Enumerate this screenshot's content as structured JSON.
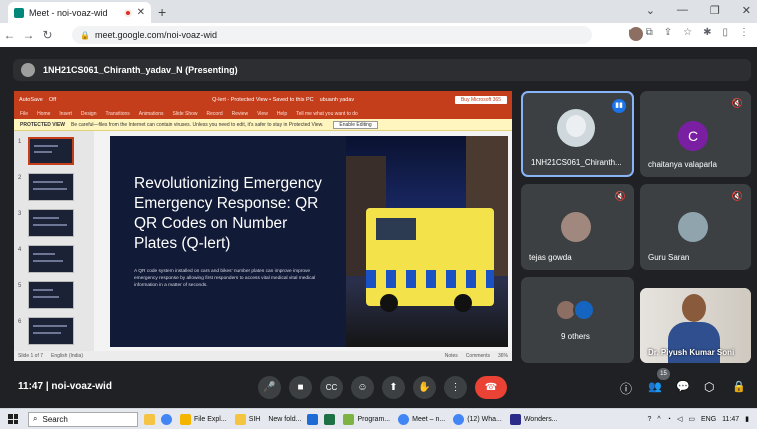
{
  "browser": {
    "tab_title": "Meet - noi-voaz-wid",
    "new_tab": "+",
    "tab_close": "✕",
    "window_controls": [
      "⌄",
      "—",
      "❐",
      "✕"
    ],
    "url": "meet.google.com/noi-voaz-wid"
  },
  "presenting_bar": {
    "label": "1NH21CS061_Chiranth_yadav_N (Presenting)"
  },
  "ppt": {
    "autosave": "AutoSave",
    "autosave_state": "Off",
    "doc_title": "Q-lert - Protected View • Saved to this PC",
    "user": "ubuanh yadav",
    "buy": "Buy Microsoft 365",
    "menu": [
      "File",
      "Home",
      "Insert",
      "Design",
      "Transitions",
      "Animations",
      "Slide Show",
      "Record",
      "Review",
      "View",
      "Help",
      "Tell me what you want to do"
    ],
    "protected_label": "PROTECTED VIEW",
    "protected_msg": "Be careful—files from the Internet can contain viruses. Unless you need to edit, it's safer to stay in Protected View.",
    "enable_editing": "Enable Editing",
    "thumb_numbers": [
      "1",
      "2",
      "3",
      "4",
      "5",
      "6"
    ],
    "status_left": "Slide 1 of 7",
    "status_lang": "English (India)",
    "status_notes": "Notes",
    "status_comments": "Comments",
    "zoom": "36%"
  },
  "slide": {
    "title": "Revolutionizing Emergency Emergency Response: QR QR Codes on Number Plates (Q-lert)",
    "body": "A QR code system installed on cars and bikes' number plates can improve improve emergency response by allowing first responders to access vital medical vital medical information in a matter of seconds."
  },
  "participants": [
    {
      "name": "1NH21CS061_Chiranth...",
      "speaking": true
    },
    {
      "name": "chaitanya valaparla",
      "initial": "C",
      "color": "#7b1fa2"
    },
    {
      "name": "tejas gowda"
    },
    {
      "name": "Guru Saran"
    },
    {
      "name": "9 others"
    },
    {
      "name": "Dr. Piyush Kumar Soni"
    }
  ],
  "meeting": {
    "time": "11:47",
    "code": "noi-voaz-wid",
    "participant_count": "15"
  },
  "controls": {
    "mic": "🎤",
    "camera": "■",
    "captions": "CC",
    "emoji": "☺",
    "present": "⬆",
    "hand": "✋",
    "more": "⋮",
    "end": "☎",
    "info": "ⓘ",
    "people": "👥",
    "chat": "💬",
    "activities": "⬡",
    "host": "🔒"
  },
  "taskbar": {
    "search": "Search",
    "apps": [
      "File Expl...",
      "SIH",
      "New fold...",
      "Program...",
      "Meet – n...",
      "(12) Wha...",
      "Wonders..."
    ],
    "tray_lang": "ENG",
    "tray_time": "11:47"
  },
  "colors": {
    "ppt_red": "#c43e1c",
    "meet_bg": "#202124",
    "tile_bg": "#3c4043",
    "end_call": "#ea4335",
    "active_border": "#8ab4f8"
  }
}
